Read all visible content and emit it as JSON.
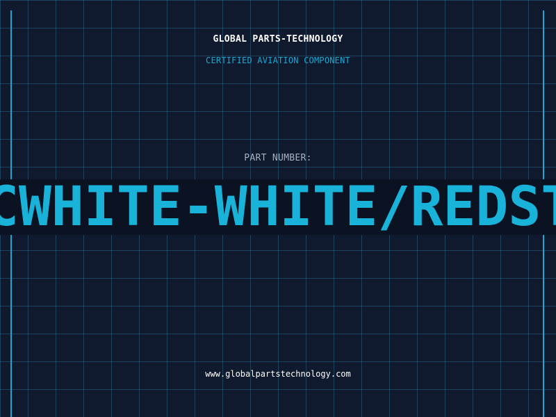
{
  "header": {
    "company": "GLOBAL PARTS-TECHNOLOGY",
    "tagline": "CERTIFIED AVIATION COMPONENT"
  },
  "part": {
    "label": "PART NUMBER:",
    "value": "CWHITE-WHITE/REDSTW"
  },
  "footer": {
    "website": "www.globalpartstechnology.com"
  },
  "colors": {
    "background": "#101a2e",
    "grid": "#388caa",
    "accent": "#19a9d6",
    "text_primary": "#ffffff",
    "text_muted": "#a7b3c2"
  }
}
